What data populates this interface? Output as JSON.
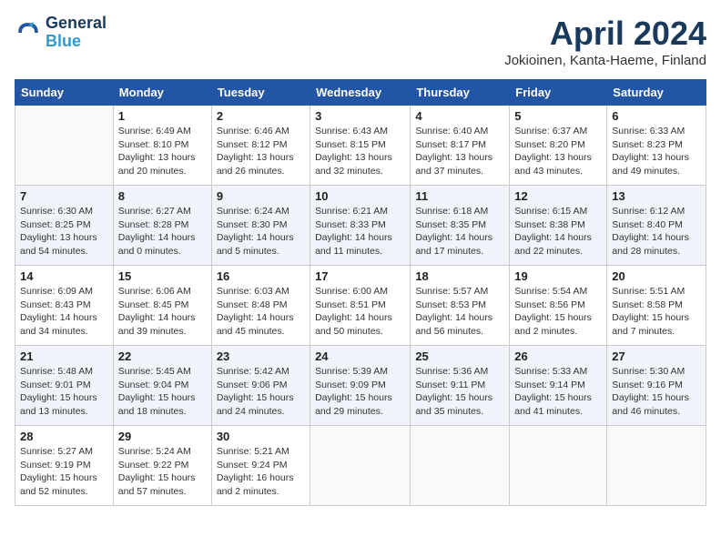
{
  "header": {
    "logo_line1": "General",
    "logo_line2": "Blue",
    "month": "April 2024",
    "location": "Jokioinen, Kanta-Haeme, Finland"
  },
  "weekdays": [
    "Sunday",
    "Monday",
    "Tuesday",
    "Wednesday",
    "Thursday",
    "Friday",
    "Saturday"
  ],
  "weeks": [
    [
      {
        "day": "",
        "info": ""
      },
      {
        "day": "1",
        "info": "Sunrise: 6:49 AM\nSunset: 8:10 PM\nDaylight: 13 hours\nand 20 minutes."
      },
      {
        "day": "2",
        "info": "Sunrise: 6:46 AM\nSunset: 8:12 PM\nDaylight: 13 hours\nand 26 minutes."
      },
      {
        "day": "3",
        "info": "Sunrise: 6:43 AM\nSunset: 8:15 PM\nDaylight: 13 hours\nand 32 minutes."
      },
      {
        "day": "4",
        "info": "Sunrise: 6:40 AM\nSunset: 8:17 PM\nDaylight: 13 hours\nand 37 minutes."
      },
      {
        "day": "5",
        "info": "Sunrise: 6:37 AM\nSunset: 8:20 PM\nDaylight: 13 hours\nand 43 minutes."
      },
      {
        "day": "6",
        "info": "Sunrise: 6:33 AM\nSunset: 8:23 PM\nDaylight: 13 hours\nand 49 minutes."
      }
    ],
    [
      {
        "day": "7",
        "info": "Sunrise: 6:30 AM\nSunset: 8:25 PM\nDaylight: 13 hours\nand 54 minutes."
      },
      {
        "day": "8",
        "info": "Sunrise: 6:27 AM\nSunset: 8:28 PM\nDaylight: 14 hours\nand 0 minutes."
      },
      {
        "day": "9",
        "info": "Sunrise: 6:24 AM\nSunset: 8:30 PM\nDaylight: 14 hours\nand 5 minutes."
      },
      {
        "day": "10",
        "info": "Sunrise: 6:21 AM\nSunset: 8:33 PM\nDaylight: 14 hours\nand 11 minutes."
      },
      {
        "day": "11",
        "info": "Sunrise: 6:18 AM\nSunset: 8:35 PM\nDaylight: 14 hours\nand 17 minutes."
      },
      {
        "day": "12",
        "info": "Sunrise: 6:15 AM\nSunset: 8:38 PM\nDaylight: 14 hours\nand 22 minutes."
      },
      {
        "day": "13",
        "info": "Sunrise: 6:12 AM\nSunset: 8:40 PM\nDaylight: 14 hours\nand 28 minutes."
      }
    ],
    [
      {
        "day": "14",
        "info": "Sunrise: 6:09 AM\nSunset: 8:43 PM\nDaylight: 14 hours\nand 34 minutes."
      },
      {
        "day": "15",
        "info": "Sunrise: 6:06 AM\nSunset: 8:45 PM\nDaylight: 14 hours\nand 39 minutes."
      },
      {
        "day": "16",
        "info": "Sunrise: 6:03 AM\nSunset: 8:48 PM\nDaylight: 14 hours\nand 45 minutes."
      },
      {
        "day": "17",
        "info": "Sunrise: 6:00 AM\nSunset: 8:51 PM\nDaylight: 14 hours\nand 50 minutes."
      },
      {
        "day": "18",
        "info": "Sunrise: 5:57 AM\nSunset: 8:53 PM\nDaylight: 14 hours\nand 56 minutes."
      },
      {
        "day": "19",
        "info": "Sunrise: 5:54 AM\nSunset: 8:56 PM\nDaylight: 15 hours\nand 2 minutes."
      },
      {
        "day": "20",
        "info": "Sunrise: 5:51 AM\nSunset: 8:58 PM\nDaylight: 15 hours\nand 7 minutes."
      }
    ],
    [
      {
        "day": "21",
        "info": "Sunrise: 5:48 AM\nSunset: 9:01 PM\nDaylight: 15 hours\nand 13 minutes."
      },
      {
        "day": "22",
        "info": "Sunrise: 5:45 AM\nSunset: 9:04 PM\nDaylight: 15 hours\nand 18 minutes."
      },
      {
        "day": "23",
        "info": "Sunrise: 5:42 AM\nSunset: 9:06 PM\nDaylight: 15 hours\nand 24 minutes."
      },
      {
        "day": "24",
        "info": "Sunrise: 5:39 AM\nSunset: 9:09 PM\nDaylight: 15 hours\nand 29 minutes."
      },
      {
        "day": "25",
        "info": "Sunrise: 5:36 AM\nSunset: 9:11 PM\nDaylight: 15 hours\nand 35 minutes."
      },
      {
        "day": "26",
        "info": "Sunrise: 5:33 AM\nSunset: 9:14 PM\nDaylight: 15 hours\nand 41 minutes."
      },
      {
        "day": "27",
        "info": "Sunrise: 5:30 AM\nSunset: 9:16 PM\nDaylight: 15 hours\nand 46 minutes."
      }
    ],
    [
      {
        "day": "28",
        "info": "Sunrise: 5:27 AM\nSunset: 9:19 PM\nDaylight: 15 hours\nand 52 minutes."
      },
      {
        "day": "29",
        "info": "Sunrise: 5:24 AM\nSunset: 9:22 PM\nDaylight: 15 hours\nand 57 minutes."
      },
      {
        "day": "30",
        "info": "Sunrise: 5:21 AM\nSunset: 9:24 PM\nDaylight: 16 hours\nand 2 minutes."
      },
      {
        "day": "",
        "info": ""
      },
      {
        "day": "",
        "info": ""
      },
      {
        "day": "",
        "info": ""
      },
      {
        "day": "",
        "info": ""
      }
    ]
  ]
}
